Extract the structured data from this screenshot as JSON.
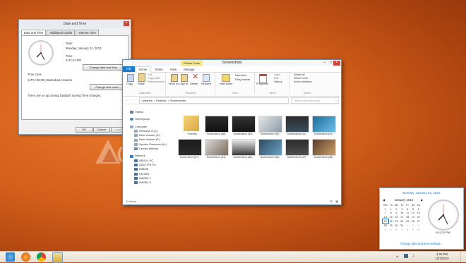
{
  "dialog": {
    "title": "Date and Time",
    "tabs": [
      "Date and Time",
      "Additional Clocks",
      "Internet Time"
    ],
    "date_label": "Date:",
    "date_value": "Monday, January 21, 2013",
    "time_label": "Time:",
    "time_value": "4:31:21 PM",
    "change_date_button": "Change date and time...",
    "timezone_label": "Time zone",
    "timezone_value": "(UTC+05:00) Islamabad, Karachi",
    "change_timezone_button": "Change time zone...",
    "dst_note": "There are no upcoming Daylight Saving Time changes.",
    "ok": "OK",
    "cancel": "Cancel",
    "apply": "Apply"
  },
  "explorer": {
    "title": "Screenshots",
    "contextual_tab": "Picture Tools",
    "ribbon_tabs": [
      "File",
      "Home",
      "Share",
      "View",
      "Manage"
    ],
    "groups": {
      "clipboard": {
        "name": "Clipboard",
        "copy": "Copy",
        "paste": "Paste",
        "cut": "Cut",
        "copy_path": "Copy path",
        "paste_shortcut": "Paste shortcut"
      },
      "organize": {
        "name": "Organize",
        "move_to": "Move to",
        "copy_to": "Copy to",
        "delete": "Delete",
        "rename": "Rename"
      },
      "new": {
        "name": "New",
        "new_folder": "New folder",
        "new_item": "New item",
        "easy_access": "Easy access"
      },
      "open": {
        "name": "Open",
        "properties": "Properties",
        "open": "Open",
        "edit": "Edit",
        "history": "History"
      },
      "select": {
        "name": "Select",
        "select_all": "Select all",
        "select_none": "Select none",
        "invert_selection": "Invert selection"
      }
    },
    "address": [
      "Libraries",
      "Pictures",
      "Screenshots"
    ],
    "search_placeholder": "Search Screenshots",
    "nav": {
      "favorites": [
        "Videos"
      ],
      "homegroup": "Homegroup",
      "computer": "Computer",
      "drives": [
        "Windows 8 (C:)",
        "New Volume (D:)",
        "New Volume (E:)",
        "System Reserved (H:)",
        "Usman (fatima)"
      ],
      "network": "Network",
      "network_items": [
        "ABDUL-PC",
        "ADDTIPS-PC",
        "BIMZIE",
        "FATIMA",
        "NAVAD-T",
        "NAVAD-X"
      ]
    },
    "items": [
      "Themes",
      "Screenshot (38)",
      "Screenshot (39)",
      "Screenshot (40)",
      "Screenshot (41)",
      "Screenshot (42)",
      "Screenshot (37)",
      "Screenshot (44)",
      "Screenshot (45)",
      "Screenshot (46)",
      "Screenshot (47)",
      "Screenshot (48)"
    ],
    "status": "11 items"
  },
  "calendar": {
    "long_date": "Monday, January 21, 2013",
    "month_title": "January 2013",
    "weekdays": [
      "Mo",
      "Tu",
      "We",
      "Th",
      "Fr",
      "Sa",
      "Su"
    ],
    "weeks": [
      [
        "31",
        "1",
        "2",
        "3",
        "4",
        "5",
        "6"
      ],
      [
        "7",
        "8",
        "9",
        "10",
        "11",
        "12",
        "13"
      ],
      [
        "14",
        "15",
        "16",
        "17",
        "18",
        "19",
        "20"
      ],
      [
        "21",
        "22",
        "23",
        "24",
        "25",
        "26",
        "27"
      ],
      [
        "28",
        "29",
        "30",
        "31",
        "1",
        "2",
        "3"
      ],
      [
        "4",
        "5",
        "6",
        "7",
        "8",
        "9",
        "10"
      ]
    ],
    "time": "4:31:21 PM",
    "settings_link": "Change date and time settings..."
  },
  "taskbar": {
    "time": "4:31 PM",
    "date": "1/21/2013",
    "apps": [
      "ie-icon",
      "firefox-icon",
      "chrome-icon",
      "explorer-icon"
    ]
  },
  "colors": {
    "accent": "#1979ca",
    "desktop": "#d25e1a",
    "close": "#c8463a"
  }
}
